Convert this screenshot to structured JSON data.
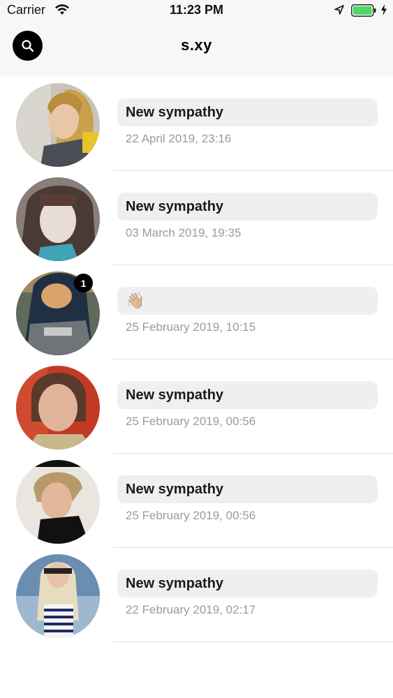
{
  "status_bar": {
    "carrier": "Carrier",
    "time": "11:23 PM",
    "battery_color": "#4cd964",
    "wifi_icon": "wifi-icon",
    "location_icon": "location-arrow-icon",
    "charging_icon": "bolt-icon"
  },
  "nav": {
    "title": "s.xy",
    "search_icon": "search-icon"
  },
  "chats": [
    {
      "preview": "New sympathy",
      "timestamp": "22 April 2019, 23:16",
      "unread": ""
    },
    {
      "preview": "New sympathy",
      "timestamp": "03 March 2019, 19:35",
      "unread": ""
    },
    {
      "preview": "👋🏼",
      "timestamp": "25 February 2019, 10:15",
      "unread": "1"
    },
    {
      "preview": "New sympathy",
      "timestamp": "25 February 2019, 00:56",
      "unread": ""
    },
    {
      "preview": "New sympathy",
      "timestamp": "25 February 2019, 00:56",
      "unread": ""
    },
    {
      "preview": "New sympathy",
      "timestamp": "22 February 2019, 02:17",
      "unread": ""
    }
  ],
  "colors": {
    "bubble_bg": "#efeff2",
    "timestamp": "#9b9b9b",
    "bar_bg": "#f7f7f7"
  }
}
